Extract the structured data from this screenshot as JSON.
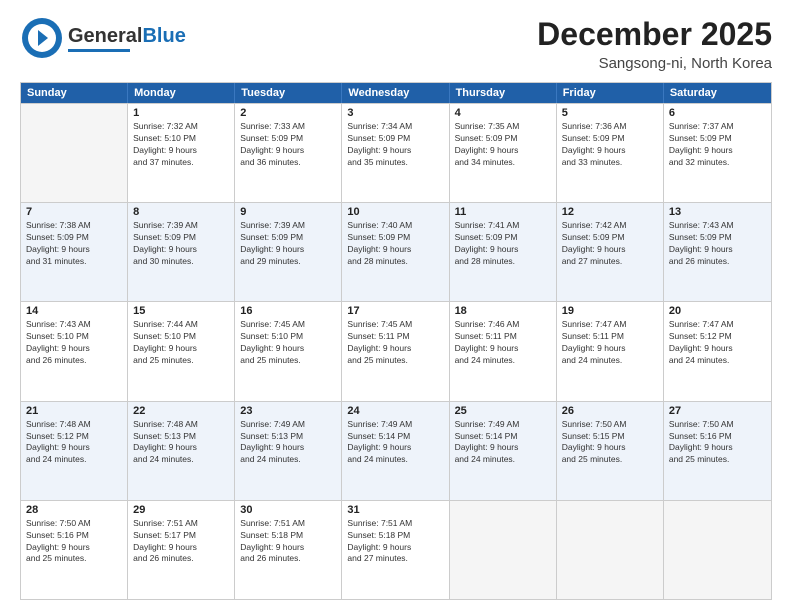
{
  "logo": {
    "line1": "General",
    "line2": "Blue"
  },
  "title": "December 2025",
  "subtitle": "Sangsong-ni, North Korea",
  "weekdays": [
    "Sunday",
    "Monday",
    "Tuesday",
    "Wednesday",
    "Thursday",
    "Friday",
    "Saturday"
  ],
  "weeks": [
    [
      {
        "day": "",
        "detail": ""
      },
      {
        "day": "1",
        "detail": "Sunrise: 7:32 AM\nSunset: 5:10 PM\nDaylight: 9 hours\nand 37 minutes."
      },
      {
        "day": "2",
        "detail": "Sunrise: 7:33 AM\nSunset: 5:09 PM\nDaylight: 9 hours\nand 36 minutes."
      },
      {
        "day": "3",
        "detail": "Sunrise: 7:34 AM\nSunset: 5:09 PM\nDaylight: 9 hours\nand 35 minutes."
      },
      {
        "day": "4",
        "detail": "Sunrise: 7:35 AM\nSunset: 5:09 PM\nDaylight: 9 hours\nand 34 minutes."
      },
      {
        "day": "5",
        "detail": "Sunrise: 7:36 AM\nSunset: 5:09 PM\nDaylight: 9 hours\nand 33 minutes."
      },
      {
        "day": "6",
        "detail": "Sunrise: 7:37 AM\nSunset: 5:09 PM\nDaylight: 9 hours\nand 32 minutes."
      }
    ],
    [
      {
        "day": "7",
        "detail": "Sunrise: 7:38 AM\nSunset: 5:09 PM\nDaylight: 9 hours\nand 31 minutes."
      },
      {
        "day": "8",
        "detail": "Sunrise: 7:39 AM\nSunset: 5:09 PM\nDaylight: 9 hours\nand 30 minutes."
      },
      {
        "day": "9",
        "detail": "Sunrise: 7:39 AM\nSunset: 5:09 PM\nDaylight: 9 hours\nand 29 minutes."
      },
      {
        "day": "10",
        "detail": "Sunrise: 7:40 AM\nSunset: 5:09 PM\nDaylight: 9 hours\nand 28 minutes."
      },
      {
        "day": "11",
        "detail": "Sunrise: 7:41 AM\nSunset: 5:09 PM\nDaylight: 9 hours\nand 28 minutes."
      },
      {
        "day": "12",
        "detail": "Sunrise: 7:42 AM\nSunset: 5:09 PM\nDaylight: 9 hours\nand 27 minutes."
      },
      {
        "day": "13",
        "detail": "Sunrise: 7:43 AM\nSunset: 5:09 PM\nDaylight: 9 hours\nand 26 minutes."
      }
    ],
    [
      {
        "day": "14",
        "detail": "Sunrise: 7:43 AM\nSunset: 5:10 PM\nDaylight: 9 hours\nand 26 minutes."
      },
      {
        "day": "15",
        "detail": "Sunrise: 7:44 AM\nSunset: 5:10 PM\nDaylight: 9 hours\nand 25 minutes."
      },
      {
        "day": "16",
        "detail": "Sunrise: 7:45 AM\nSunset: 5:10 PM\nDaylight: 9 hours\nand 25 minutes."
      },
      {
        "day": "17",
        "detail": "Sunrise: 7:45 AM\nSunset: 5:11 PM\nDaylight: 9 hours\nand 25 minutes."
      },
      {
        "day": "18",
        "detail": "Sunrise: 7:46 AM\nSunset: 5:11 PM\nDaylight: 9 hours\nand 24 minutes."
      },
      {
        "day": "19",
        "detail": "Sunrise: 7:47 AM\nSunset: 5:11 PM\nDaylight: 9 hours\nand 24 minutes."
      },
      {
        "day": "20",
        "detail": "Sunrise: 7:47 AM\nSunset: 5:12 PM\nDaylight: 9 hours\nand 24 minutes."
      }
    ],
    [
      {
        "day": "21",
        "detail": "Sunrise: 7:48 AM\nSunset: 5:12 PM\nDaylight: 9 hours\nand 24 minutes."
      },
      {
        "day": "22",
        "detail": "Sunrise: 7:48 AM\nSunset: 5:13 PM\nDaylight: 9 hours\nand 24 minutes."
      },
      {
        "day": "23",
        "detail": "Sunrise: 7:49 AM\nSunset: 5:13 PM\nDaylight: 9 hours\nand 24 minutes."
      },
      {
        "day": "24",
        "detail": "Sunrise: 7:49 AM\nSunset: 5:14 PM\nDaylight: 9 hours\nand 24 minutes."
      },
      {
        "day": "25",
        "detail": "Sunrise: 7:49 AM\nSunset: 5:14 PM\nDaylight: 9 hours\nand 24 minutes."
      },
      {
        "day": "26",
        "detail": "Sunrise: 7:50 AM\nSunset: 5:15 PM\nDaylight: 9 hours\nand 25 minutes."
      },
      {
        "day": "27",
        "detail": "Sunrise: 7:50 AM\nSunset: 5:16 PM\nDaylight: 9 hours\nand 25 minutes."
      }
    ],
    [
      {
        "day": "28",
        "detail": "Sunrise: 7:50 AM\nSunset: 5:16 PM\nDaylight: 9 hours\nand 25 minutes."
      },
      {
        "day": "29",
        "detail": "Sunrise: 7:51 AM\nSunset: 5:17 PM\nDaylight: 9 hours\nand 26 minutes."
      },
      {
        "day": "30",
        "detail": "Sunrise: 7:51 AM\nSunset: 5:18 PM\nDaylight: 9 hours\nand 26 minutes."
      },
      {
        "day": "31",
        "detail": "Sunrise: 7:51 AM\nSunset: 5:18 PM\nDaylight: 9 hours\nand 27 minutes."
      },
      {
        "day": "",
        "detail": ""
      },
      {
        "day": "",
        "detail": ""
      },
      {
        "day": "",
        "detail": ""
      }
    ]
  ]
}
